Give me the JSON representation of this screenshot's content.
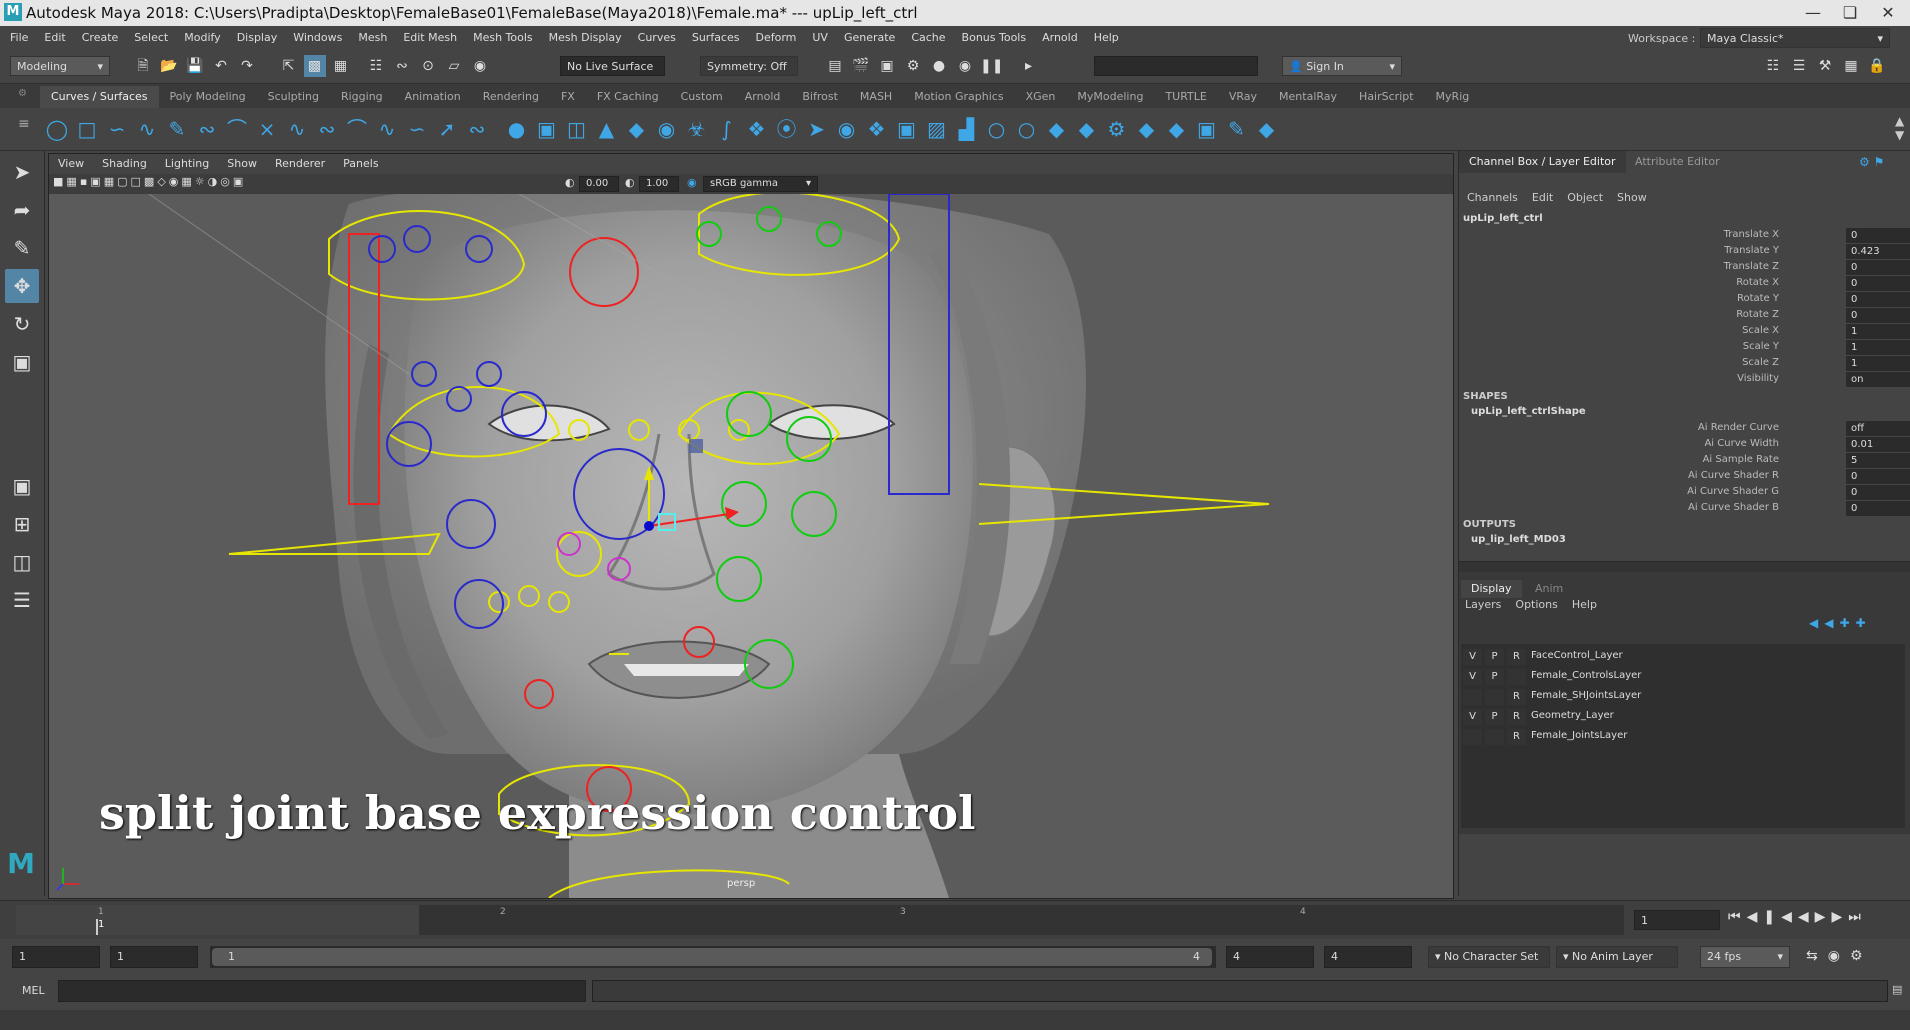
{
  "titlebar": {
    "text": "Autodesk Maya 2018: C:\\Users\\Pradipta\\Desktop\\FemaleBase01\\FemaleBase(Maya2018)\\Female.ma*   ---   upLip_left_ctrl"
  },
  "menus": [
    "File",
    "Edit",
    "Create",
    "Select",
    "Modify",
    "Display",
    "Windows",
    "Mesh",
    "Edit Mesh",
    "Mesh Tools",
    "Mesh Display",
    "Curves",
    "Surfaces",
    "Deform",
    "UV",
    "Generate",
    "Cache",
    "Bonus Tools",
    "Arnold",
    "Help"
  ],
  "workspace": {
    "label": "Workspace :",
    "value": "Maya Classic*"
  },
  "status": {
    "mode": "Modeling",
    "live_surface": "No Live Surface",
    "symmetry": "Symmetry: Off",
    "sign_in": "Sign In"
  },
  "shelf_tabs": [
    "Curves / Surfaces",
    "Poly Modeling",
    "Sculpting",
    "Rigging",
    "Animation",
    "Rendering",
    "FX",
    "FX Caching",
    "Custom",
    "Arnold",
    "Bifrost",
    "MASH",
    "Motion Graphics",
    "XGen",
    "MyModeling",
    "TURTLE",
    "VRay",
    "MentalRay",
    "HairScript",
    "MyRig"
  ],
  "viewport": {
    "menus": [
      "View",
      "Shading",
      "Lighting",
      "Show",
      "Renderer",
      "Panels"
    ],
    "exposure": "0.00",
    "gamma": "1.00",
    "colorspace": "sRGB gamma",
    "camera": "persp",
    "overlay_text": "split joint base expression control"
  },
  "channel_box": {
    "tabs": [
      "Channel Box / Layer Editor",
      "Attribute Editor"
    ],
    "menus": [
      "Channels",
      "Edit",
      "Object",
      "Show"
    ],
    "object_name": "upLip_left_ctrl",
    "attributes": [
      {
        "label": "Translate X",
        "value": "0"
      },
      {
        "label": "Translate Y",
        "value": "0.423"
      },
      {
        "label": "Translate Z",
        "value": "0"
      },
      {
        "label": "Rotate X",
        "value": "0"
      },
      {
        "label": "Rotate Y",
        "value": "0"
      },
      {
        "label": "Rotate Z",
        "value": "0"
      },
      {
        "label": "Scale X",
        "value": "1"
      },
      {
        "label": "Scale Y",
        "value": "1"
      },
      {
        "label": "Scale Z",
        "value": "1"
      },
      {
        "label": "Visibility",
        "value": "on"
      }
    ],
    "shapes_header": "SHAPES",
    "shape_name": "upLip_left_ctrlShape",
    "shape_attributes": [
      {
        "label": "Ai Render Curve",
        "value": "off"
      },
      {
        "label": "Ai Curve Width",
        "value": "0.01"
      },
      {
        "label": "Ai Sample Rate",
        "value": "5"
      },
      {
        "label": "Ai Curve Shader R",
        "value": "0"
      },
      {
        "label": "Ai Curve Shader G",
        "value": "0"
      },
      {
        "label": "Ai Curve Shader B",
        "value": "0"
      }
    ],
    "outputs_header": "OUTPUTS",
    "output_name": "up_lip_left_MD03"
  },
  "layer_editor": {
    "tabs": [
      "Display",
      "Anim"
    ],
    "menus": [
      "Layers",
      "Options",
      "Help"
    ],
    "layers": [
      {
        "v": "V",
        "p": "P",
        "r": "R",
        "name": "FaceControl_Layer"
      },
      {
        "v": "V",
        "p": "P",
        "r": "",
        "name": "Female_ControlsLayer"
      },
      {
        "v": "",
        "p": "",
        "r": "R",
        "name": "Female_SHJointsLayer"
      },
      {
        "v": "V",
        "p": "P",
        "r": "R",
        "name": "Geometry_Layer"
      },
      {
        "v": "",
        "p": "",
        "r": "R",
        "name": "Female_JointsLayer"
      }
    ]
  },
  "timeline": {
    "ticks": [
      "1",
      "2",
      "3",
      "4"
    ],
    "current_frame": "1",
    "current_frame_field": "1"
  },
  "range": {
    "start": "1",
    "playback_start": "1",
    "slider_start": "1",
    "slider_end": "4",
    "playback_end": "4",
    "end": "4",
    "character_set": "No Character Set",
    "anim_layer": "No Anim Layer",
    "fps": "24 fps"
  },
  "cmdline": {
    "label": "MEL"
  }
}
